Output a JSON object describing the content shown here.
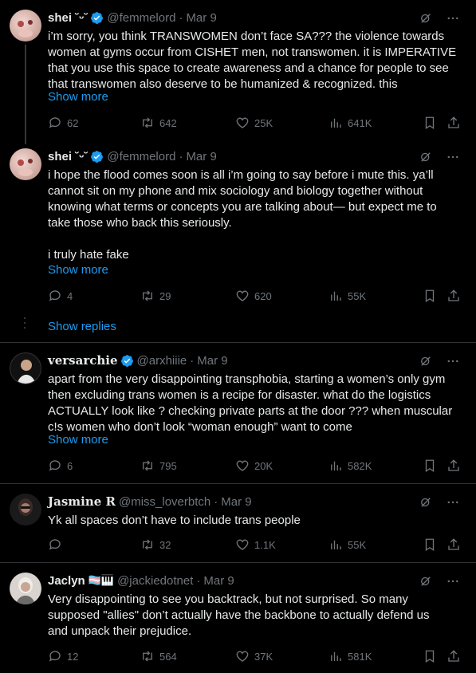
{
  "tweets": [
    {
      "name": "shei ˘ᵕ˘",
      "handle": "@femmelord",
      "dot": "·",
      "date": "Mar 9",
      "verified": true,
      "lines": [
        "i’m sorry, you think TRANSWOMEN don’t face SA??? the violence towards",
        "women at gyms occur from CISHET men, not transwomen. it is IMPERATIVE",
        "that you use this space to create awareness and a chance for people to see",
        "that transwomen also deserve to be humanized & recognized. this"
      ],
      "show_more": "Show more",
      "replies": "62",
      "retweets": "642",
      "likes": "25K",
      "views": "641K"
    },
    {
      "name": "shei ˘ᵕ˘",
      "handle": "@femmelord",
      "dot": "·",
      "date": "Mar 9",
      "verified": true,
      "lines": [
        "i hope the flood comes soon is all i’m going to say before i mute this. ya’ll",
        "cannot sit on my phone and mix sociology and biology together without",
        "knowing what terms or concepts you are talking about— but expect me to",
        "take those who back this seriously.",
        "",
        "i truly hate fake"
      ],
      "show_more": "Show more",
      "replies": "4",
      "retweets": "29",
      "likes": "620",
      "views": "55K"
    },
    {
      "name": "versarchie",
      "handle": "@arxhiiie",
      "dot": "·",
      "date": "Mar 9",
      "verified": true,
      "lines": [
        "apart from the very disappointing transphobia, starting a women’s only gym",
        "then excluding trans women is a recipe for disaster. what do the logistics",
        "ACTUALLY look like ? checking private parts at the door ??? when muscular",
        "c!s women who don’t look “woman enough” want to come"
      ],
      "show_more": "Show more",
      "replies": "6",
      "retweets": "795",
      "likes": "20K",
      "views": "582K"
    },
    {
      "name": "Jasmine R",
      "handle": "@miss_loverbtch",
      "dot": "·",
      "date": "Mar 9",
      "verified": false,
      "lines": [
        "Yk all spaces don’t have to include trans people"
      ],
      "show_more": "",
      "replies": "",
      "retweets": "32",
      "likes": "1.1K",
      "views": "55K"
    },
    {
      "name": "Jaclyn",
      "handle": "@jackiedotnet",
      "dot": "·",
      "date": "Mar 9",
      "verified": false,
      "emoji": "🏳️‍⚧️🎹",
      "lines": [
        "Very disappointing to see you backtrack, but not surprised. So many",
        "supposed \"allies\" don’t actually have the backbone to actually defend us",
        "and unpack their prejudice."
      ],
      "show_more": "",
      "replies": "12",
      "retweets": "564",
      "likes": "37K",
      "views": "581K"
    }
  ],
  "show_replies": "Show replies",
  "colors": {
    "accent": "#1d9bf0",
    "muted": "#71767b",
    "text": "#e7e9ea",
    "background": "#000000"
  }
}
